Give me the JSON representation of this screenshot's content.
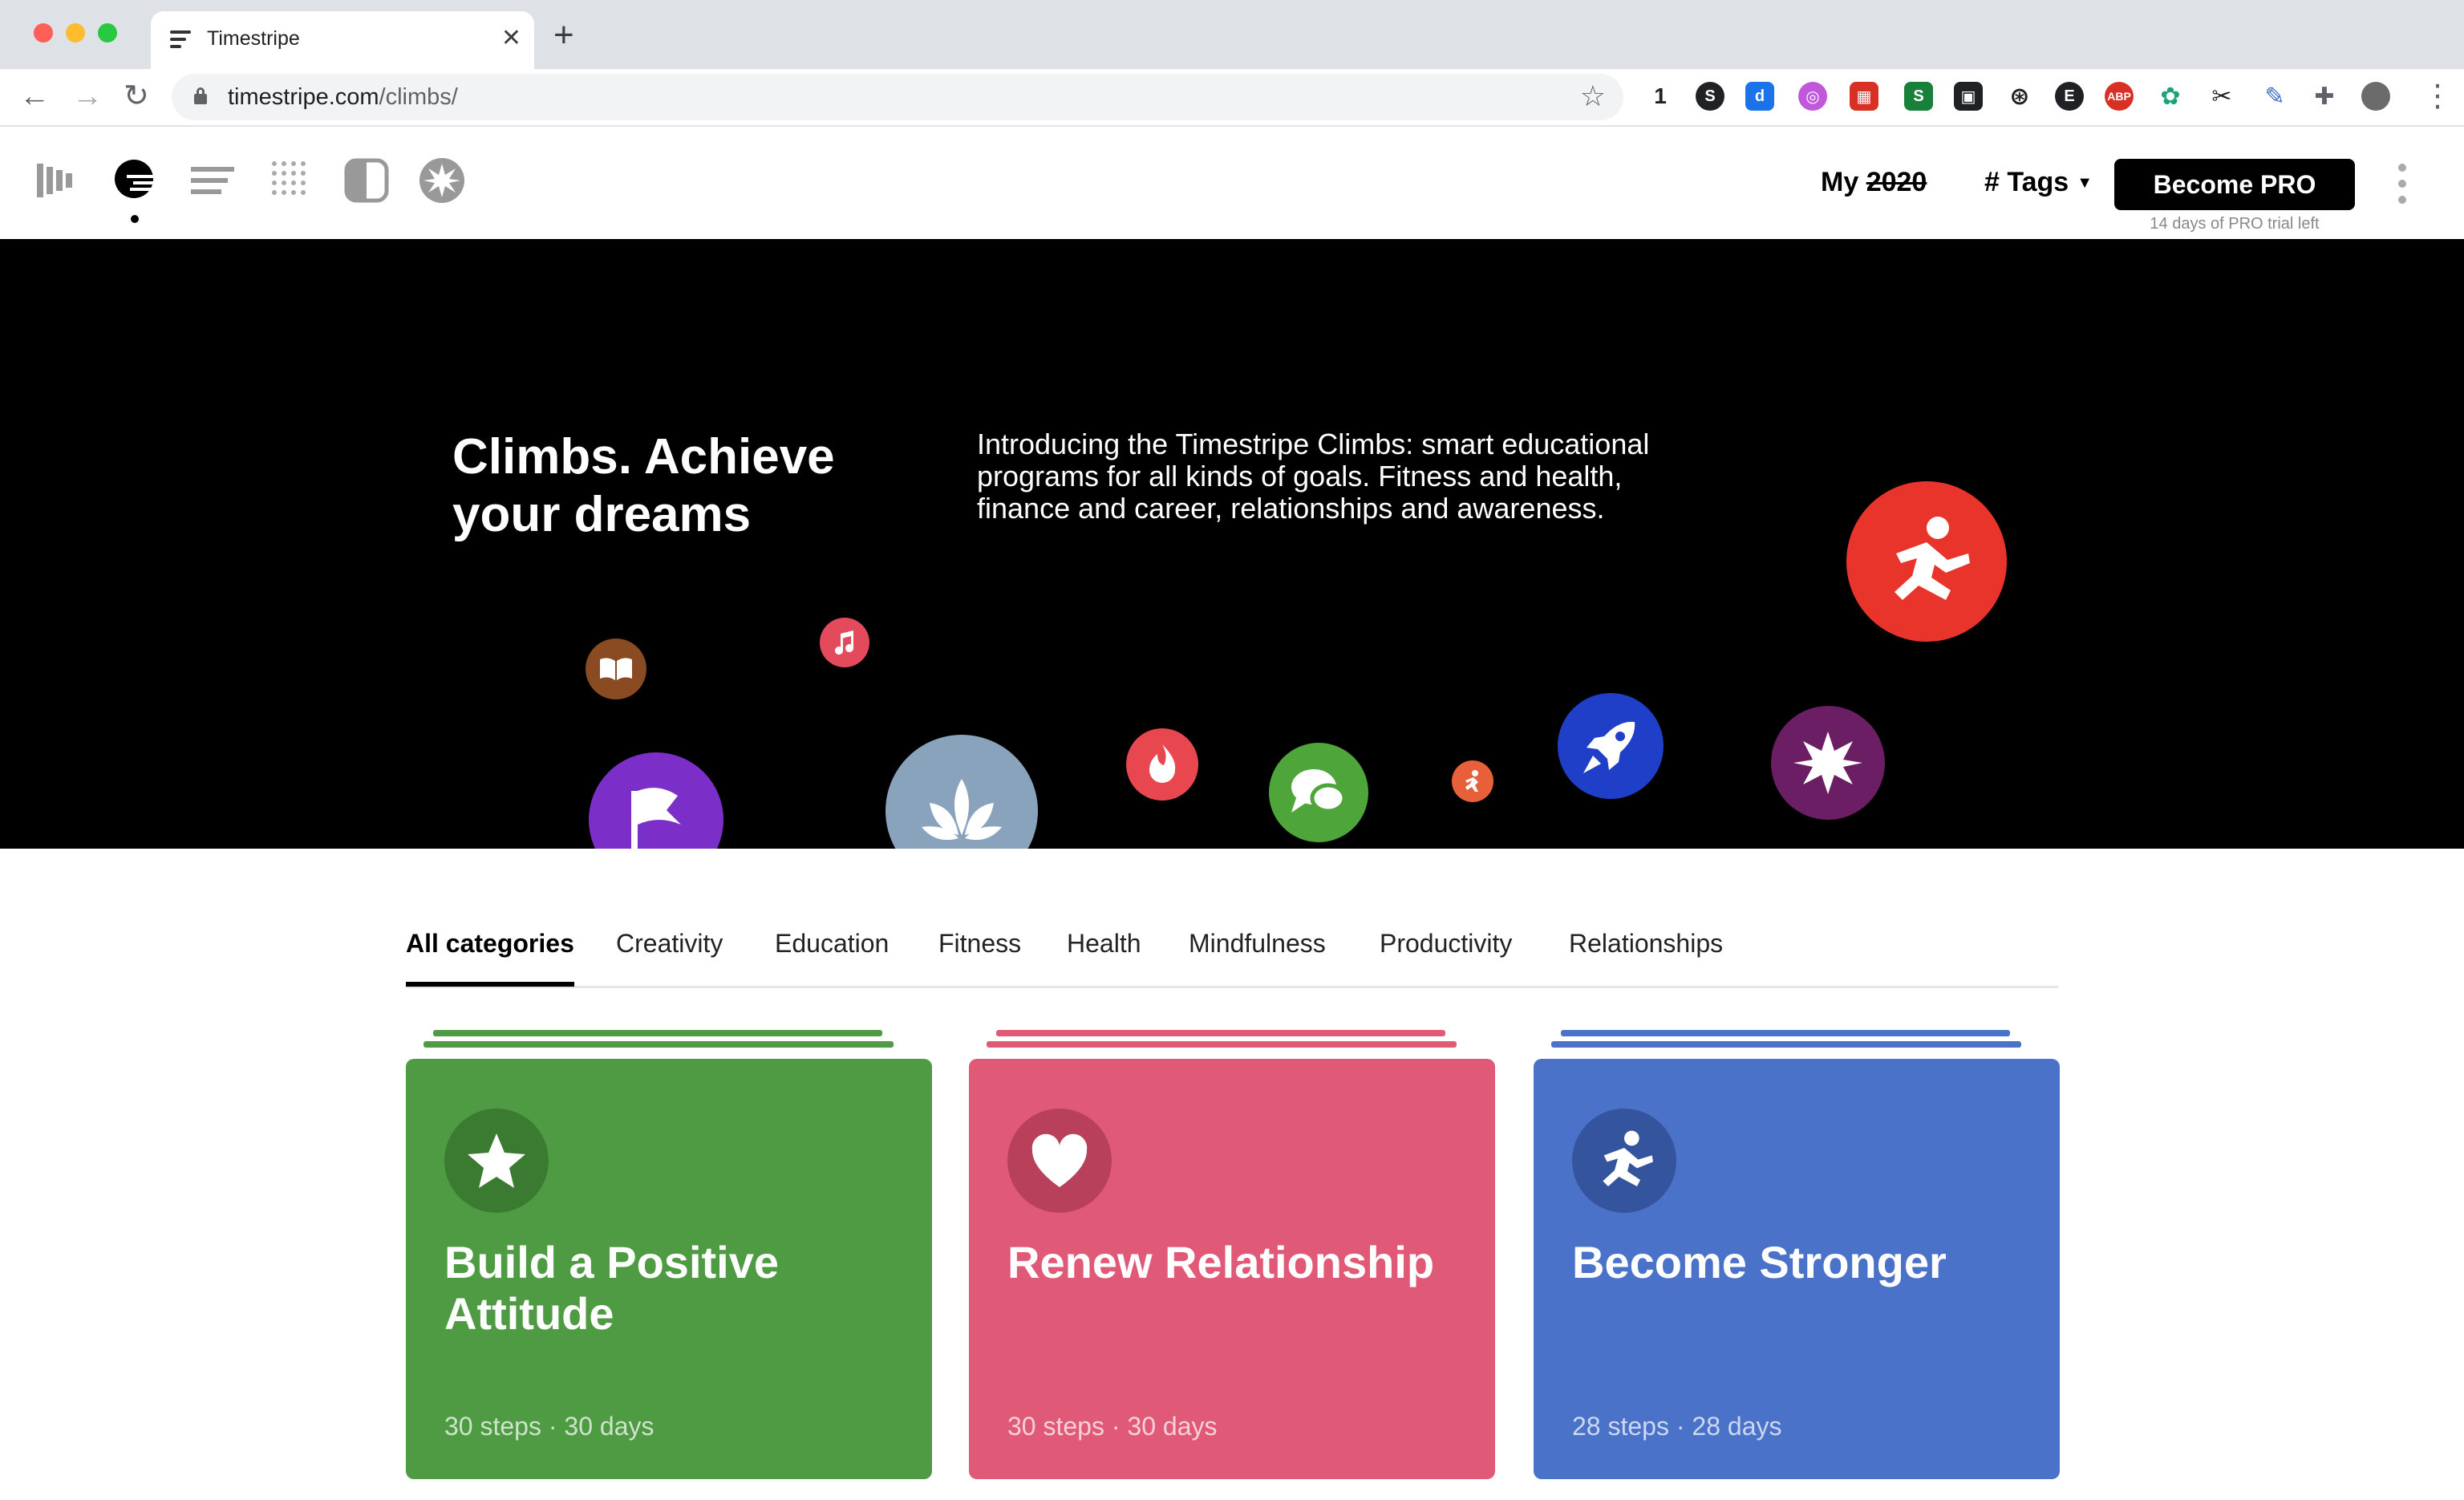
{
  "browser": {
    "tab_title": "Timestripe",
    "url_host": "timestripe.com",
    "url_path": "/climbs/",
    "extension_count_label": "1"
  },
  "header": {
    "my_label": "My",
    "my_year": "2020",
    "tags_label": "# Tags",
    "pro_button": "Become PRO",
    "pro_note": "14 days of PRO trial left"
  },
  "hero": {
    "title": "Climbs. Achieve your dreams",
    "description": "Introducing the Timestripe Climbs: smart educational programs for all kinds of goals. Fitness and health, finance and career, relationships and awareness."
  },
  "categories": [
    {
      "label": "All categories",
      "active": true
    },
    {
      "label": "Creativity"
    },
    {
      "label": "Education"
    },
    {
      "label": "Fitness"
    },
    {
      "label": "Health"
    },
    {
      "label": "Mindfulness"
    },
    {
      "label": "Productivity"
    },
    {
      "label": "Relationships"
    }
  ],
  "cards": [
    {
      "title": "Build a Positive Attitude",
      "meta": "30 steps · 30 days",
      "color": "#4e9b43",
      "icon_bg": "#3a7a31",
      "icon": "star-icon"
    },
    {
      "title": "Renew Relationship",
      "meta": "30 steps · 30 days",
      "color": "#e05a78",
      "icon_bg": "#b8405a",
      "icon": "heart-icon"
    },
    {
      "title": "Become Stronger",
      "meta": "28 steps · 28 days",
      "color": "#4a72c9",
      "icon_bg": "#34559e",
      "icon": "runner-icon"
    }
  ],
  "colors": {
    "accent": "#000000",
    "hero_bg": "#000000"
  }
}
